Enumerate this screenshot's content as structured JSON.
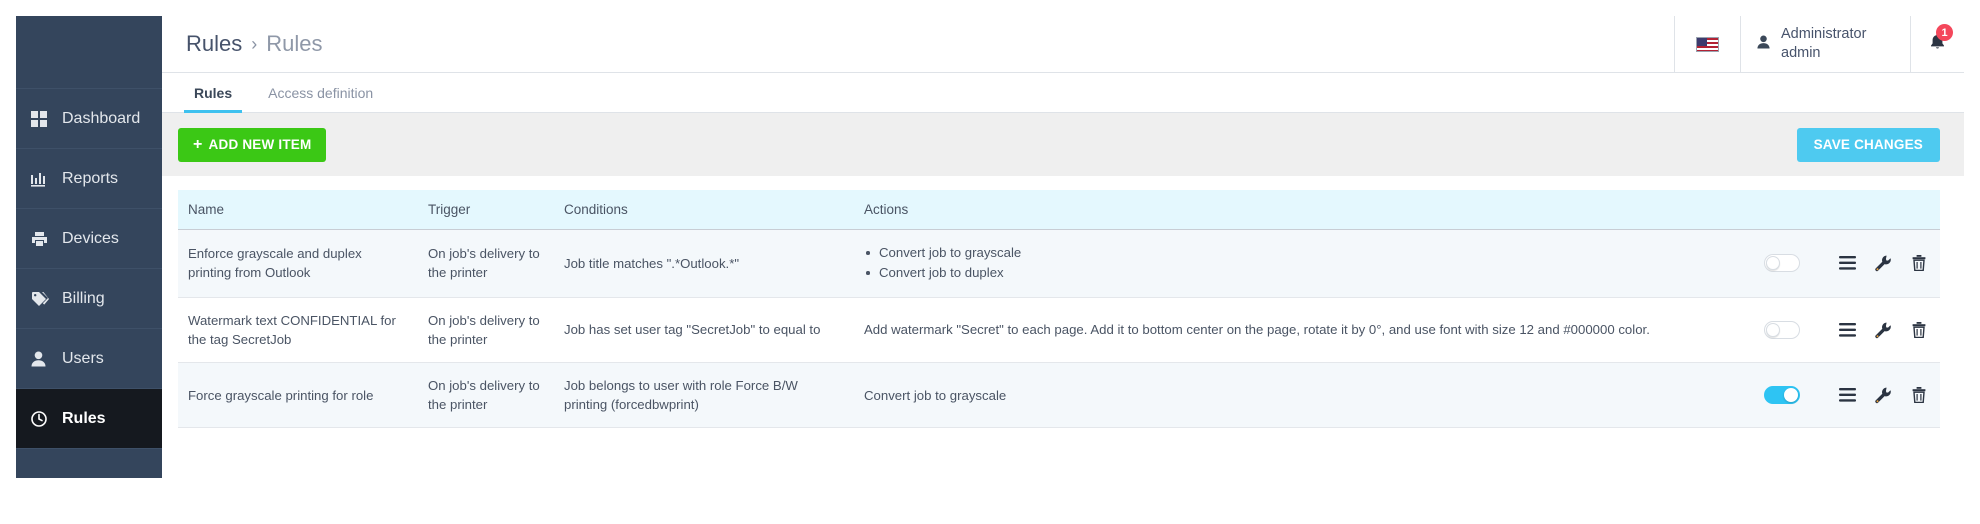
{
  "sidebar": {
    "items": [
      {
        "label": "Dashboard",
        "icon": "grid-icon",
        "active": false
      },
      {
        "label": "Reports",
        "icon": "bar-chart-icon",
        "active": false
      },
      {
        "label": "Devices",
        "icon": "printer-icon",
        "active": false
      },
      {
        "label": "Billing",
        "icon": "tag-icon",
        "active": false
      },
      {
        "label": "Users",
        "icon": "user-icon",
        "active": false
      },
      {
        "label": "Rules",
        "icon": "clock-icon",
        "active": true
      }
    ]
  },
  "header": {
    "breadcrumb_root": "Rules",
    "breadcrumb_sep": "›",
    "breadcrumb_current": "Rules",
    "language_icon": "us-flag-icon",
    "user_icon": "user-icon",
    "user_name_line1": "Administrator",
    "user_name_line2": "admin",
    "bell_icon": "bell-icon",
    "notification_count": "1"
  },
  "tabs": [
    {
      "label": "Rules",
      "active": true
    },
    {
      "label": "Access definition",
      "active": false
    }
  ],
  "toolbar": {
    "add_label": "ADD NEW ITEM",
    "add_plus": "+",
    "save_label": "SAVE CHANGES"
  },
  "table": {
    "columns": [
      "Name",
      "Trigger",
      "Conditions",
      "Actions",
      ""
    ],
    "rows": [
      {
        "name": "Enforce grayscale and duplex printing from Outlook",
        "trigger": "On job's delivery to the printer",
        "conditions": "Job title matches \".*Outlook.*\"",
        "actions_list": [
          "Convert job to grayscale",
          "Convert job to duplex"
        ],
        "actions_text": "",
        "enabled": false,
        "row_icons": [
          "menu-icon",
          "wrench-icon",
          "trash-icon"
        ]
      },
      {
        "name": "Watermark text CONFIDENTIAL for the tag SecretJob",
        "trigger": "On job's delivery to the printer",
        "conditions": "Job has set user tag \"SecretJob\" to equal to",
        "actions_list": [],
        "actions_text": "Add watermark \"Secret\" to each page. Add it to bottom center on the page, rotate it by 0°, and use font with size 12 and #000000 color.",
        "enabled": false,
        "row_icons": [
          "menu-icon",
          "wrench-icon",
          "trash-icon"
        ]
      },
      {
        "name": "Force grayscale printing for role",
        "trigger": "On job's delivery to the printer",
        "conditions": "Job belongs to user with role Force B/W printing (forcedbwprint)",
        "actions_list": [],
        "actions_text": "Convert job to grayscale",
        "enabled": true,
        "row_icons": [
          "menu-icon",
          "wrench-icon",
          "trash-icon"
        ]
      }
    ]
  },
  "colors": {
    "sidebar_bg": "#34455c",
    "sidebar_active_bg": "#15191f",
    "accent_cyan": "#4ecaf0",
    "accent_green": "#3bc815",
    "badge_red": "#f4475b",
    "table_head_bg": "#e4f8fe",
    "toolbar_bg": "#efefef"
  }
}
